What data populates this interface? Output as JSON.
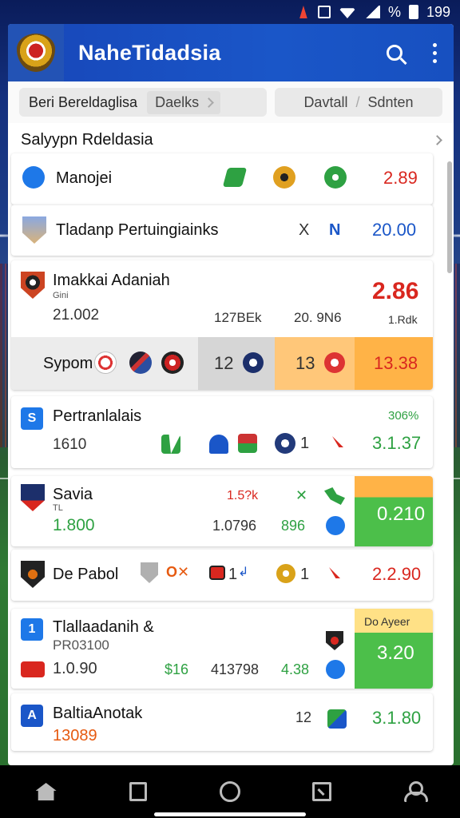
{
  "status": {
    "pct": "%",
    "batt_text": "199"
  },
  "header": {
    "title": "NaheTidadsia"
  },
  "filters": {
    "chip1_label": "Beri Bereldaglisa",
    "chip1_sub": "Daelks",
    "chip2_a": "Davtall",
    "chip2_b": "Sdnten"
  },
  "section": {
    "title": "Salyypn Rdeldasia"
  },
  "rows": {
    "r1": {
      "name": "Manojei",
      "odds": "2.89"
    },
    "r2": {
      "name": "Tladanp Pertuingiainks",
      "x": "X",
      "n": "N",
      "odds": "20.00"
    },
    "r3": {
      "name": "Imakkai Adaniah",
      "sub": "Gini",
      "val": "21.002",
      "a": "127BEk",
      "b": "20. 9N6",
      "c": "1.Rdk",
      "odds": "2.86"
    },
    "r3b": {
      "name": "Sypom",
      "v1": "12",
      "v2": "13",
      "odds": "13.38"
    },
    "r4": {
      "name": "Pertranlalais",
      "pct": "306%",
      "val": "1610",
      "n1": "1",
      "odds": "3.1.37"
    },
    "r5": {
      "name": "Savia",
      "sub": "TL",
      "red": "1.5?k",
      "val": "1.800",
      "a": "1.0796",
      "b": "896",
      "odds": "0.210"
    },
    "r6": {
      "name": "De Pabol",
      "n1": "1",
      "n2": "1",
      "odds": "2.2.90"
    },
    "r7": {
      "name": "Tlallaadanih &",
      "sub": "PR03100",
      "val": "1.0.90",
      "g": "$16",
      "a": "413798",
      "b": "4.38",
      "tag": "Do Ayeer",
      "odds": "3.20"
    },
    "r8": {
      "name": "BaltiaAnotak",
      "val": "13089",
      "a": "12",
      "odds": "3.1.80"
    }
  },
  "icons": {
    "status": [
      "alarm-icon",
      "vibrate-icon",
      "wifi-icon",
      "signal-icon",
      "battery-icon"
    ],
    "nav": [
      "home-icon",
      "bookmark-icon",
      "circle-home-icon",
      "share-icon",
      "profile-icon"
    ]
  },
  "colors": {
    "brand": "#1a56c8",
    "odds_red": "#d9271f",
    "odds_green": "#2ea142",
    "highlight_orange": "#ffb347",
    "highlight_green": "#4cbf4a"
  }
}
